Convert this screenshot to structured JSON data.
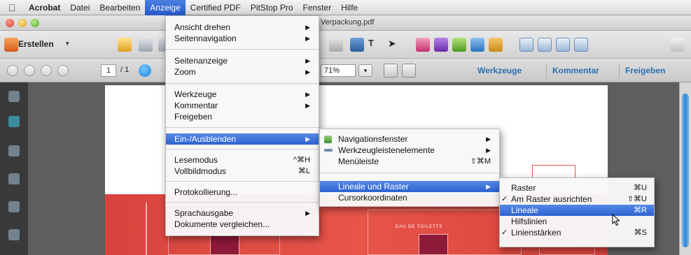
{
  "menubar": {
    "apple": "",
    "items": [
      "Acrobat",
      "Datei",
      "Bearbeiten",
      "Anzeige",
      "Certified PDF",
      "PitStop Pro",
      "Fenster",
      "Hilfe"
    ]
  },
  "window": {
    "title": "Verpackung.pdf"
  },
  "toolbar": {
    "create_label": "Erstellen",
    "create_arrow": "▾"
  },
  "nav": {
    "page_current": "1",
    "page_total": "/ 1",
    "zoom": "71%",
    "zoom_arrow": "▾"
  },
  "right_tabs": [
    "Werkzeuge",
    "Kommentar",
    "Freigeben"
  ],
  "menu_anzeige": {
    "items": [
      {
        "label": "Ansicht drehen",
        "arrow": "▶"
      },
      {
        "label": "Seitennavigation",
        "arrow": "▶"
      },
      {
        "label": "Seitenanzeige",
        "arrow": "▶"
      },
      {
        "label": "Zoom",
        "arrow": "▶"
      },
      {
        "label": "Werkzeuge",
        "arrow": "▶"
      },
      {
        "label": "Kommentar",
        "arrow": "▶"
      },
      {
        "label": "Freigeben",
        "arrow": ""
      },
      {
        "label": "Ein-/Ausblenden",
        "arrow": "▶"
      },
      {
        "label": "Lesemodus",
        "shortcut": "^⌘H"
      },
      {
        "label": "Vollbildmodus",
        "shortcut": "⌘L"
      },
      {
        "label": "Protokollierung..."
      },
      {
        "label": "Sprachausgabe",
        "arrow": "▶"
      },
      {
        "label": "Dokumente vergleichen..."
      }
    ]
  },
  "menu_einaus": {
    "items": [
      {
        "label": "Navigationsfenster",
        "arrow": "▶"
      },
      {
        "label": "Werkzeugleistenelemente",
        "arrow": "▶"
      },
      {
        "label": "Menüleiste",
        "shortcut": "⇧⌘M"
      },
      {
        "label": "Lineale und Raster",
        "arrow": "▶"
      },
      {
        "label": "Cursorkoordinaten"
      }
    ]
  },
  "menu_lineale": {
    "items": [
      {
        "label": "Raster",
        "shortcut": "⌘U",
        "checked": false
      },
      {
        "label": "Am Raster ausrichten",
        "shortcut": "⇧⌘U",
        "checked": true
      },
      {
        "label": "Lineale",
        "shortcut": "⌘R",
        "checked": false
      },
      {
        "label": "Hilfslinien",
        "shortcut": "",
        "checked": false
      },
      {
        "label": "Linienstärken",
        "shortcut": "⌘S",
        "checked": true
      }
    ],
    "check_glyph": "✓"
  },
  "document": {
    "small_label": "EAU DE TOILETTE"
  },
  "colors": {
    "accent": "#2d63cf",
    "red": "#e04d44"
  }
}
